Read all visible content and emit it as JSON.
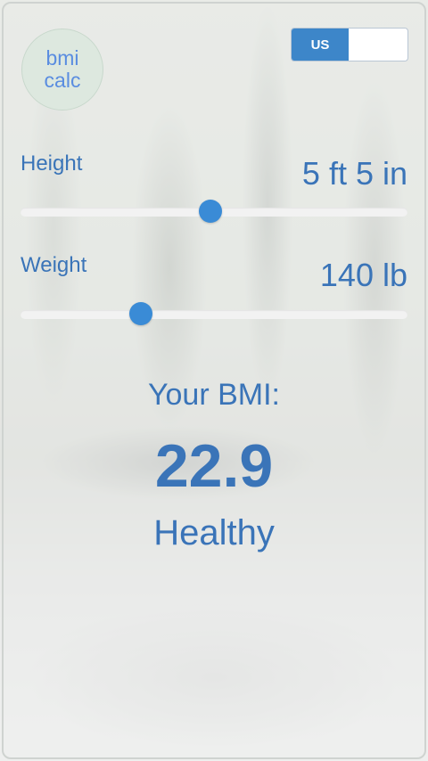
{
  "logo": {
    "line1": "bmi",
    "line2": "calc"
  },
  "unit_toggle": {
    "active": "US",
    "inactive": ""
  },
  "height": {
    "label": "Height",
    "value": "5 ft 5 in",
    "level": 0.49
  },
  "weight": {
    "label": "Weight",
    "value": "140 lb",
    "level": 0.31
  },
  "result": {
    "label": "Your BMI:",
    "value": "22.9",
    "category": "Healthy"
  },
  "colors": {
    "accent": "#3a74b8",
    "slider_thumb": "#3a8bd6",
    "toggle_active": "#3d86c9",
    "logo_text": "#5a8de0"
  }
}
